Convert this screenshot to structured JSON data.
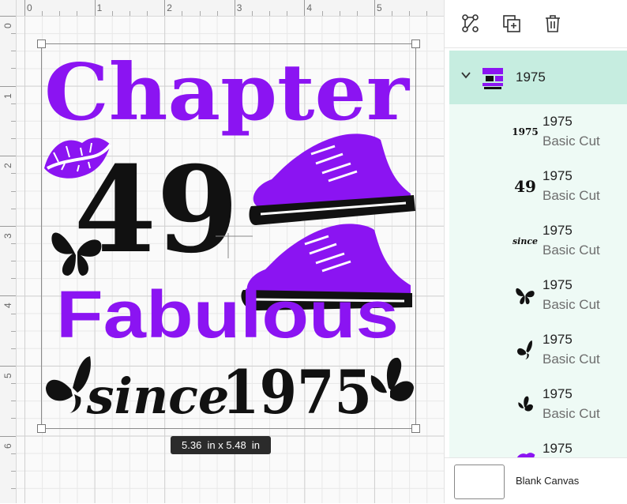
{
  "ruler": {
    "top_numbers": [
      "0",
      "1",
      "2",
      "3",
      "4",
      "5"
    ],
    "left_numbers": [
      "0",
      "1",
      "2",
      "3",
      "4",
      "5",
      "6"
    ]
  },
  "design": {
    "line1": "Chapter",
    "line2": "49",
    "line3": "Fabulous",
    "line4_script": "since",
    "line4_year": "1975",
    "accent_color": "#8b14f2",
    "dark_color": "#111111"
  },
  "dimensions": {
    "width_value": "5.36",
    "height_value": "5.48",
    "unit": "in",
    "label": "5.36  in x 5.48  in"
  },
  "toolbar": {
    "icons": [
      "group-ungroup-icon",
      "duplicate-icon",
      "delete-icon"
    ]
  },
  "layers": {
    "group": {
      "name": "1975",
      "expanded": true,
      "thumb_text": "Chapter 49 Fabulous since 1975"
    },
    "items": [
      {
        "name": "1975",
        "type": "Basic Cut",
        "thumb": "1975"
      },
      {
        "name": "1975",
        "type": "Basic Cut",
        "thumb": "49"
      },
      {
        "name": "1975",
        "type": "Basic Cut",
        "thumb": "since"
      },
      {
        "name": "1975",
        "type": "Basic Cut",
        "thumb": "butterfly"
      },
      {
        "name": "1975",
        "type": "Basic Cut",
        "thumb": "butterfly-small"
      },
      {
        "name": "1975",
        "type": "Basic Cut",
        "thumb": "butterfly-tilted"
      },
      {
        "name": "1975",
        "type": "",
        "thumb": "lips"
      }
    ]
  },
  "canvas_footer": {
    "label": "Blank Canvas"
  }
}
